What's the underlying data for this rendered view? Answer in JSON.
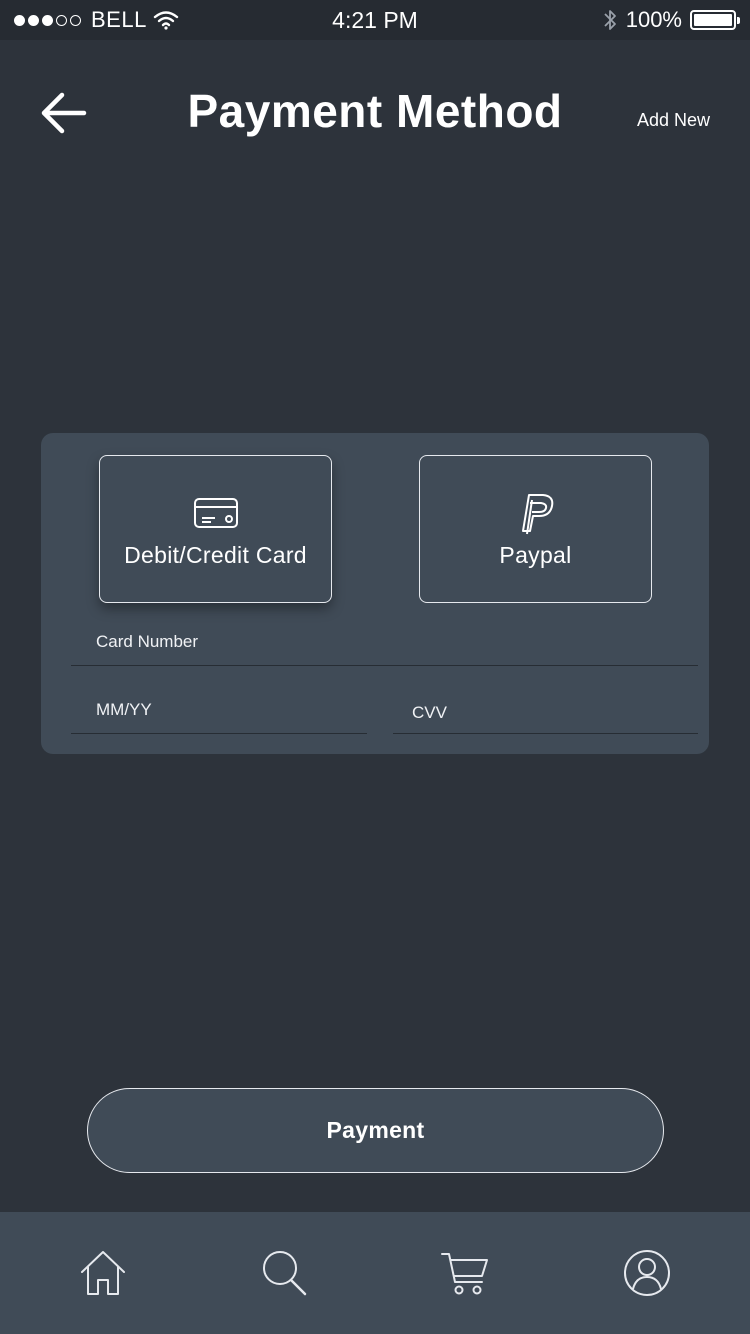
{
  "status_bar": {
    "carrier": "BELL",
    "time": "4:21 PM",
    "battery": "100%",
    "signal_bars_filled": 3,
    "signal_bars_total": 5,
    "icons": [
      "wifi-icon",
      "bluetooth-icon",
      "battery-icon"
    ]
  },
  "header": {
    "title": "Payment Method",
    "add_new_label": "Add New",
    "back_icon": "arrow-left-icon"
  },
  "methods": [
    {
      "label": "Debit/Credit Card",
      "icon": "credit-card-icon",
      "selected": true
    },
    {
      "label": "Paypal",
      "icon": "paypal-icon",
      "selected": false
    }
  ],
  "form": {
    "card_number_label": "Card Number",
    "expiry_label": "MM/YY",
    "cvv_label": "CVV"
  },
  "payment_button_label": "Payment",
  "bottom_nav": [
    {
      "name": "home",
      "icon": "home-icon"
    },
    {
      "name": "search",
      "icon": "search-icon"
    },
    {
      "name": "cart",
      "icon": "cart-icon"
    },
    {
      "name": "profile",
      "icon": "profile-icon"
    }
  ],
  "colors": {
    "background": "#2d333b",
    "panel": "#404b57",
    "status_bar": "#262b32",
    "text": "#ffffff"
  }
}
